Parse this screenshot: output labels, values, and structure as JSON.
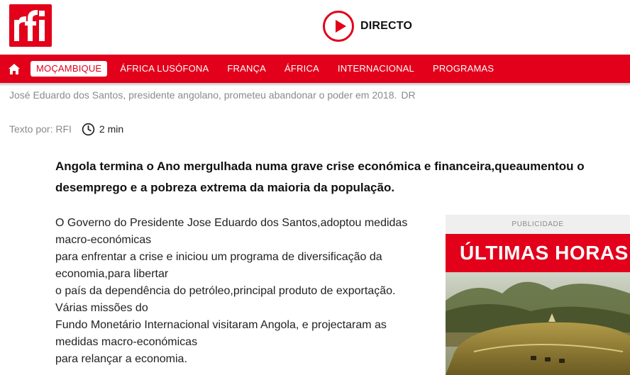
{
  "header": {
    "logo_text": "rfi",
    "live_label": "DIRECTO",
    "icons": {
      "live": "play-circle-icon",
      "home": "home-icon"
    }
  },
  "nav": {
    "items": [
      {
        "label": "MOÇAMBIQUE",
        "active": true
      },
      {
        "label": "ÁFRICA LUSÓFONA"
      },
      {
        "label": "FRANÇA"
      },
      {
        "label": "ÁFRICA"
      },
      {
        "label": "INTERNACIONAL"
      },
      {
        "label": "PROGRAMAS"
      }
    ]
  },
  "article": {
    "caption": "José Eduardo dos Santos, presidente angolano, prometeu abandonar o poder em 2018.",
    "credit": "DR",
    "author": "Texto por: RFI",
    "read_time": "2 min",
    "lead": "Angola termina o Ano mergulhada numa grave crise económica e financeira,queaumentou o desemprego e a pobreza extrema da maioria da população.",
    "body_lines": [
      "O Governo do Presidente Jose Eduardo dos Santos,adoptou medidas macro-económicas",
      "para enfrentar a crise e iniciou um programa de diversificação da economia,para libertar",
      "o país da dependência do petróleo,principal produto de exportação. Várias missões do",
      "Fundo Monetário Internacional visitaram Angola, e projectaram as medidas macro-económicas",
      "para relançar a economia."
    ]
  },
  "ad": {
    "label": "PUBLICIDADE",
    "banner": "ÚLTIMAS HORAS"
  },
  "colors": {
    "brand": "#e2001a",
    "text": "#222222",
    "muted": "#8a8a8a"
  }
}
